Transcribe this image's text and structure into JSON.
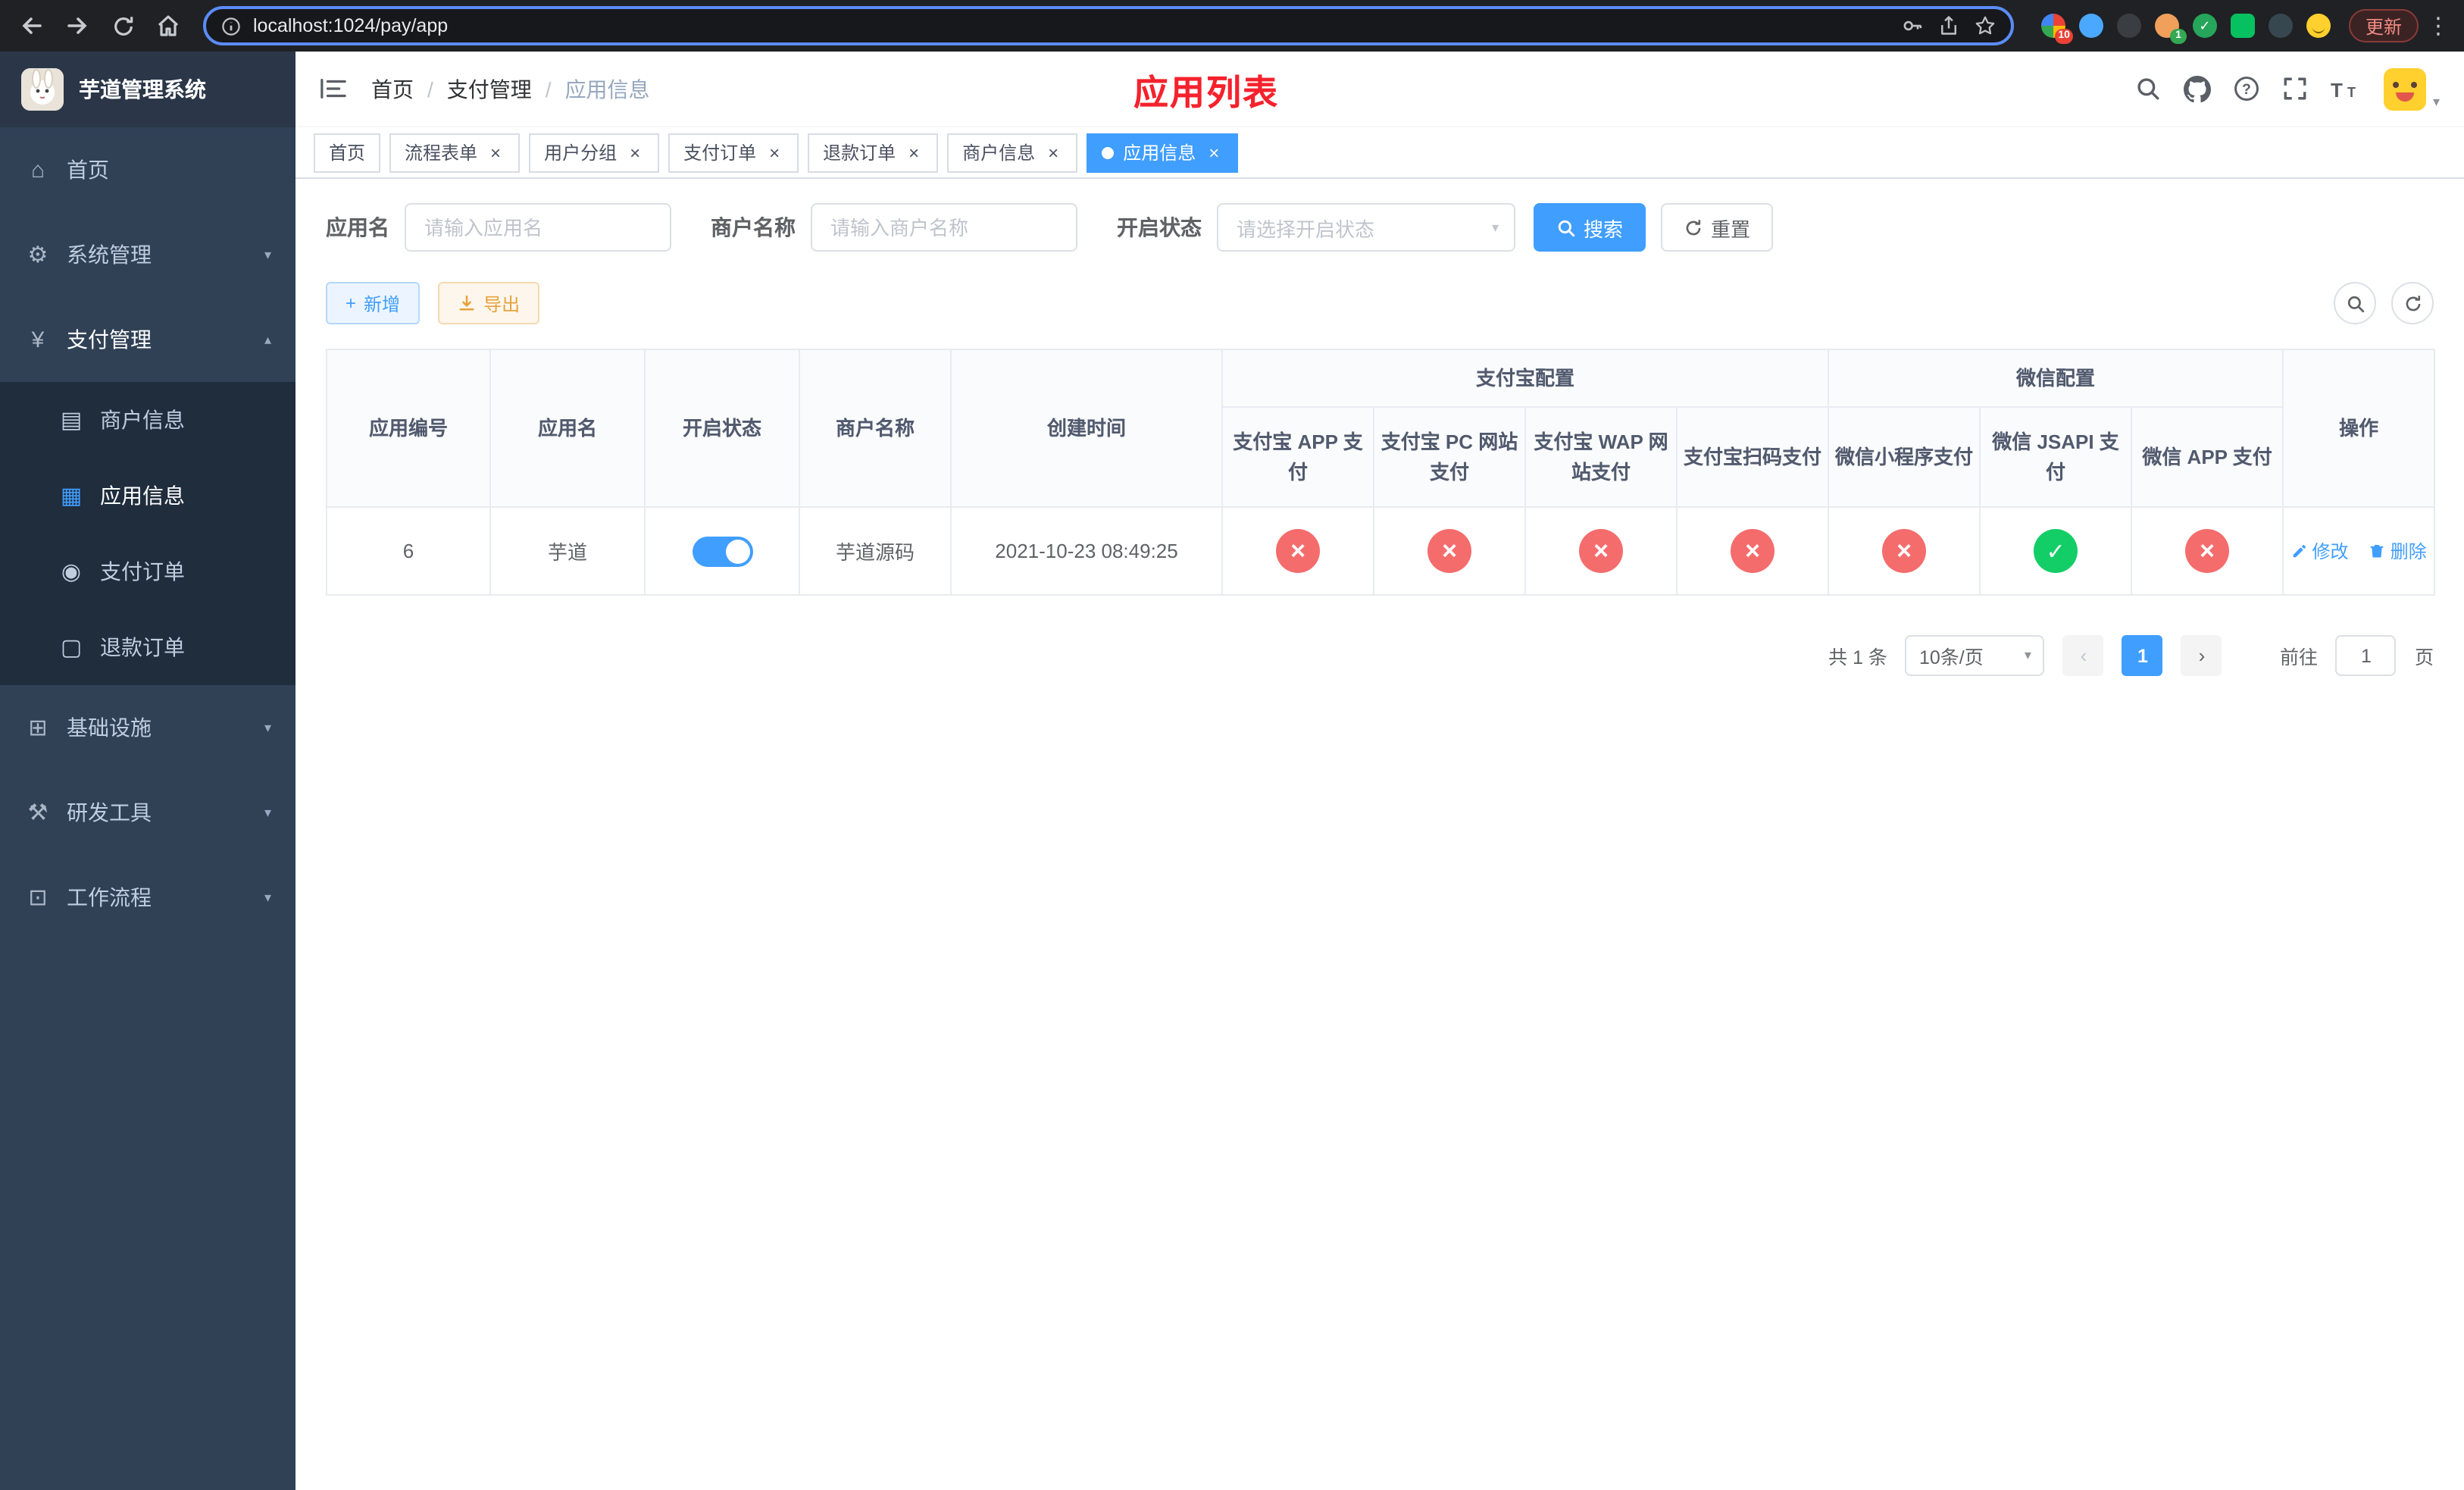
{
  "browser": {
    "url": "localhost:1024/pay/app",
    "update_label": "更新",
    "extensions_badge": "10",
    "profile_badge": "1"
  },
  "sidebar": {
    "logo_title": "芋道管理系统",
    "items": {
      "home": {
        "label": "首页",
        "glyph": "⌂"
      },
      "system": {
        "label": "系统管理",
        "glyph": "⚙"
      },
      "pay": {
        "label": "支付管理",
        "glyph": "¥"
      },
      "merchant": {
        "label": "商户信息",
        "glyph": "▤"
      },
      "app_info": {
        "label": "应用信息",
        "glyph": "▦"
      },
      "pay_order": {
        "label": "支付订单",
        "glyph": "◉"
      },
      "refund_order": {
        "label": "退款订单",
        "glyph": "▢"
      },
      "infra": {
        "label": "基础设施",
        "glyph": "⊞"
      },
      "dev_tools": {
        "label": "研发工具",
        "glyph": "⚒"
      },
      "workflow": {
        "label": "工作流程",
        "glyph": "⊡"
      }
    }
  },
  "navbar": {
    "breadcrumb": [
      "首页",
      "支付管理",
      "应用信息"
    ],
    "separator": "/",
    "page_title": "应用列表"
  },
  "tabs": [
    {
      "label": "首页"
    },
    {
      "label": "流程表单"
    },
    {
      "label": "用户分组"
    },
    {
      "label": "支付订单"
    },
    {
      "label": "退款订单"
    },
    {
      "label": "商户信息"
    },
    {
      "label": "应用信息"
    }
  ],
  "filters": {
    "app_name_label": "应用名",
    "app_name_placeholder": "请输入应用名",
    "merchant_label": "商户名称",
    "merchant_placeholder": "请输入商户名称",
    "status_label": "开启状态",
    "status_placeholder": "请选择开启状态",
    "search_button": "搜索",
    "reset_button": "重置"
  },
  "toolbar": {
    "add_button": "新增",
    "export_button": "导出"
  },
  "table": {
    "groups": {
      "alipay": "支付宝配置",
      "wechat": "微信配置"
    },
    "columns": {
      "app_id": "应用编号",
      "app_name": "应用名",
      "status": "开启状态",
      "merchant": "商户名称",
      "created": "创建时间",
      "alipay_app": "支付宝 APP 支付",
      "alipay_pc": "支付宝 PC 网站支付",
      "alipay_wap": "支付宝 WAP 网站支付",
      "alipay_qr": "支付宝扫码支付",
      "wx_mini": "微信小程序支付",
      "wx_jsapi": "微信 JSAPI 支付",
      "wx_app": "微信 APP 支付",
      "actions": "操作"
    },
    "rows": [
      {
        "app_id": "6",
        "app_name": "芋道",
        "status_on": true,
        "merchant": "芋道源码",
        "created": "2021-10-23 08:49:25",
        "configs": {
          "alipay_app": "fail",
          "alipay_pc": "fail",
          "alipay_wap": "fail",
          "alipay_qr": "fail",
          "wx_mini": "fail",
          "wx_jsapi": "pass",
          "wx_app": "fail"
        },
        "edit_label": "修改",
        "delete_label": "删除"
      }
    ]
  },
  "pagination": {
    "total_text": "共 1 条",
    "page_size": "10条/页",
    "current_page": "1",
    "goto_label": "前往",
    "goto_value": "1",
    "goto_suffix": "页"
  },
  "colors": {
    "accent_blue": "#409EFF",
    "title_red": "#f5222d",
    "pass_green": "#13ce66",
    "fail_red": "#f56c6c",
    "sidebar_bg": "#304156",
    "submenu_bg": "#1f2d3d"
  }
}
